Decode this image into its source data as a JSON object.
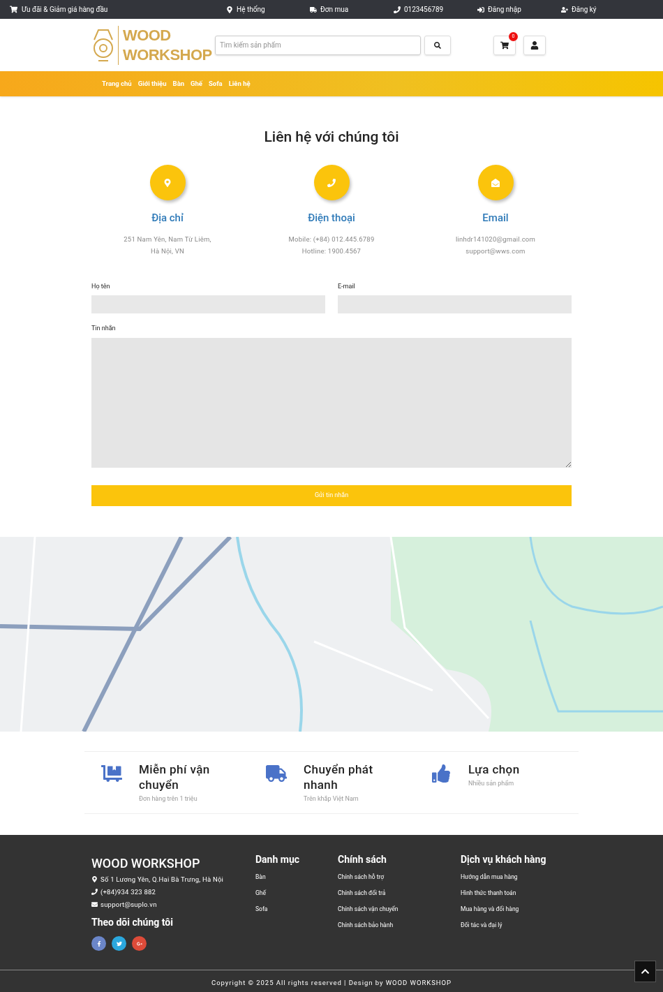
{
  "top_bar": {
    "promo": "Ưu đãi & Giảm giá hàng đầu",
    "links": [
      {
        "kind": "pin",
        "label": "Hệ thống"
      },
      {
        "kind": "truck",
        "label": "Đơn mua"
      },
      {
        "kind": "phone",
        "label": "0123456789"
      },
      {
        "kind": "login",
        "label": "Đăng nhập"
      },
      {
        "kind": "register",
        "label": "Đăng ký"
      }
    ]
  },
  "header": {
    "logo": [
      "WOOD",
      "WORKSHOP"
    ],
    "search": {
      "placeholder": "Tìm kiếm sản phẩm"
    },
    "cart_count": "0"
  },
  "nav": [
    "Trang chủ",
    "Giới thiệu",
    "Bàn",
    "Ghế",
    "Sofa",
    "Liên hệ"
  ],
  "contact": {
    "title": "Liên hệ với chúng tôi",
    "items": [
      {
        "kind": "pin",
        "heading": "Địa chỉ",
        "lines": [
          "251 Nam Yên, Nam Từ Liêm,",
          "Hà Nội, VN"
        ]
      },
      {
        "kind": "phone",
        "heading": "Điện thoại",
        "lines": [
          "Mobile: (+84) 012.445.6789",
          "Hotline: 1900.4567"
        ]
      },
      {
        "kind": "mail",
        "heading": "Email",
        "lines": [
          "linhdr141020@gmail.com",
          "support@wws.com"
        ]
      }
    ]
  },
  "form": {
    "name_label": "Họ tên",
    "email_label": "E-mail",
    "message_label": "Tin nhắn",
    "submit": "Gửi tin nhắn"
  },
  "features": [
    {
      "kind": "cart",
      "title": "Miễn phí vận chuyển",
      "subtitle": "Đơn hàng trên 1 triệu"
    },
    {
      "kind": "truck",
      "title": "Chuyển phát nhanh",
      "subtitle": "Trên khắp Việt Nam"
    },
    {
      "kind": "like",
      "title": "Lựa chọn",
      "subtitle": "Nhiều sản phẩm"
    }
  ],
  "footer": {
    "brand": "WOOD WORKSHOP",
    "contacts": [
      {
        "kind": "pin",
        "text": "Số 1 Lương Yên, Q.Hai Bà Trưng, Hà Nội"
      },
      {
        "kind": "phone",
        "text": "(+84)934 323 882"
      },
      {
        "kind": "mail",
        "text": "support@suplo.vn"
      }
    ],
    "follow": "Theo dõi chúng tôi",
    "socials": [
      {
        "kind": "facebook",
        "color": "#6b86c9"
      },
      {
        "kind": "twitter",
        "color": "#2ba8de"
      },
      {
        "kind": "google",
        "color": "#dd4b39"
      }
    ],
    "columns": [
      {
        "title": "Danh mục",
        "links": [
          "Bàn",
          "Ghế",
          "Sofa"
        ]
      },
      {
        "title": "Chính sách",
        "links": [
          "Chính sách hỗ trợ",
          "Chính sách đổi trả",
          "Chính sách vận chuyển",
          "Chính sách bảo hành"
        ]
      },
      {
        "title": "Dịch vụ khách hàng",
        "links": [
          "Hướng dẫn mua hàng",
          "Hình thức thanh toán",
          "Mua hàng và đổi hàng",
          "Đối tác và đại lý"
        ]
      }
    ],
    "copyright": "Copyright © 2025 All rights reserved | Design by WOOD WORKSHOP"
  }
}
